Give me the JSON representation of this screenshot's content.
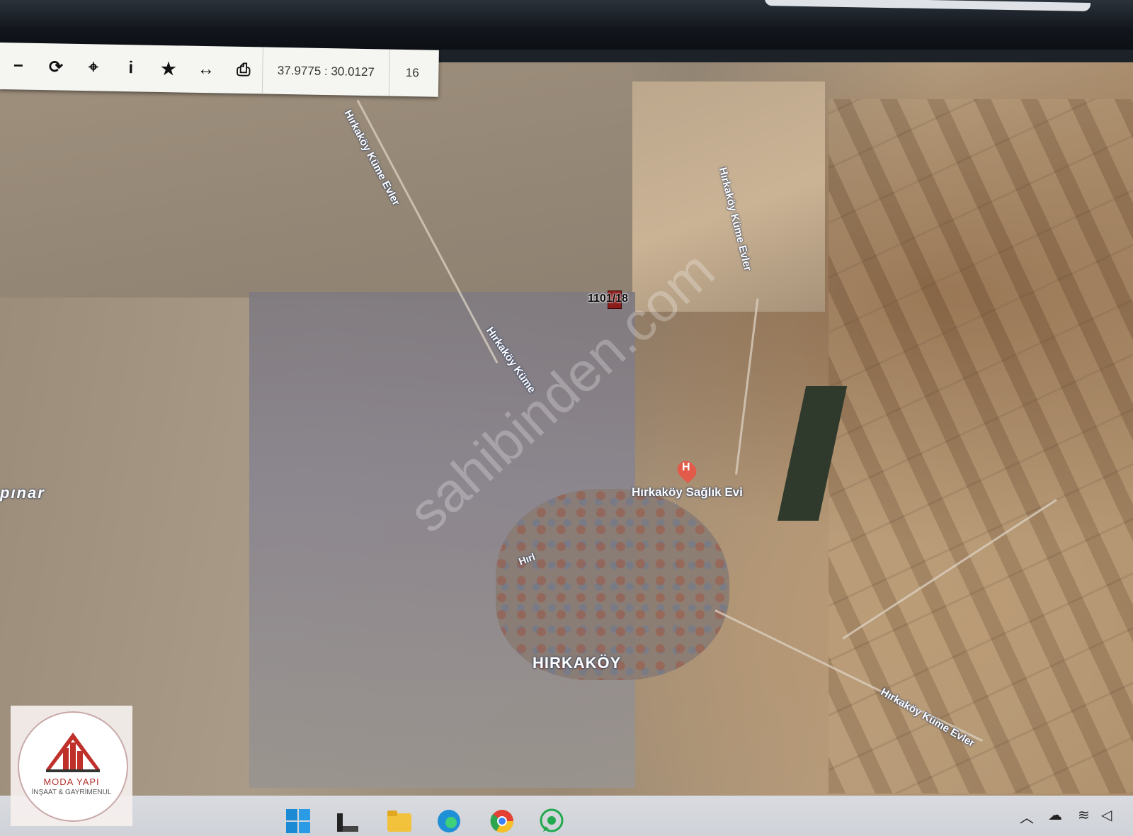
{
  "toolbar": {
    "buttons": [
      {
        "name": "zoom-out-icon",
        "glyph": "−"
      },
      {
        "name": "refresh-icon",
        "glyph": "⟳"
      },
      {
        "name": "locate-icon",
        "glyph": "⌖"
      },
      {
        "name": "info-icon",
        "glyph": "i"
      },
      {
        "name": "favorite-star-icon",
        "glyph": "★"
      },
      {
        "name": "measure-icon",
        "glyph": "↔"
      },
      {
        "name": "print-icon",
        "glyph": "⎙"
      }
    ],
    "coordinates": "37.9775 : 30.0127",
    "zoom_level": "16"
  },
  "map": {
    "parcel_label": "1101/18",
    "village_label": "HIRKAKÖY",
    "poi_label": "Hırkaköy Sağlık Evi",
    "poi_icon_letter": "H",
    "road_labels": [
      "Hırkaköy Küme Evler",
      "Hırkaköy Küme Evler",
      "Hırkaköy Küme",
      "Hırkaköy Küme Evler",
      "Hırl"
    ],
    "place_partial": "pınar",
    "watermark": "sahibinden.com"
  },
  "logo": {
    "name": "MODA YAPI",
    "subtitle": "İNŞAAT & GAYRİMENUL"
  },
  "taskbar": {
    "apps": [
      "windows-start-icon",
      "taskview-icon",
      "file-explorer-icon",
      "edge-icon",
      "chrome-icon",
      "whatsapp-icon"
    ]
  }
}
